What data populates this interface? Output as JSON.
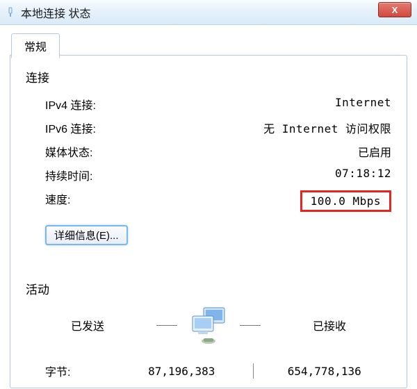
{
  "window": {
    "title": "本地连接 状态",
    "close": "X"
  },
  "tab": {
    "general": "常规"
  },
  "connection": {
    "heading": "连接",
    "ipv4_label": "IPv4 连接:",
    "ipv4_value": "Internet",
    "ipv6_label": "IPv6 连接:",
    "ipv6_value": "无 Internet 访问权限",
    "media_label": "媒体状态:",
    "media_value": "已启用",
    "duration_label": "持续时间:",
    "duration_value": "07:18:12",
    "speed_label": "速度:",
    "speed_value": "100.0 Mbps",
    "details_button": "详细信息(E)..."
  },
  "activity": {
    "heading": "活动",
    "sent_label": "已发送",
    "received_label": "已接收",
    "bytes_label": "字节:",
    "sent_bytes": "87,196,383",
    "received_bytes": "654,778,136"
  }
}
